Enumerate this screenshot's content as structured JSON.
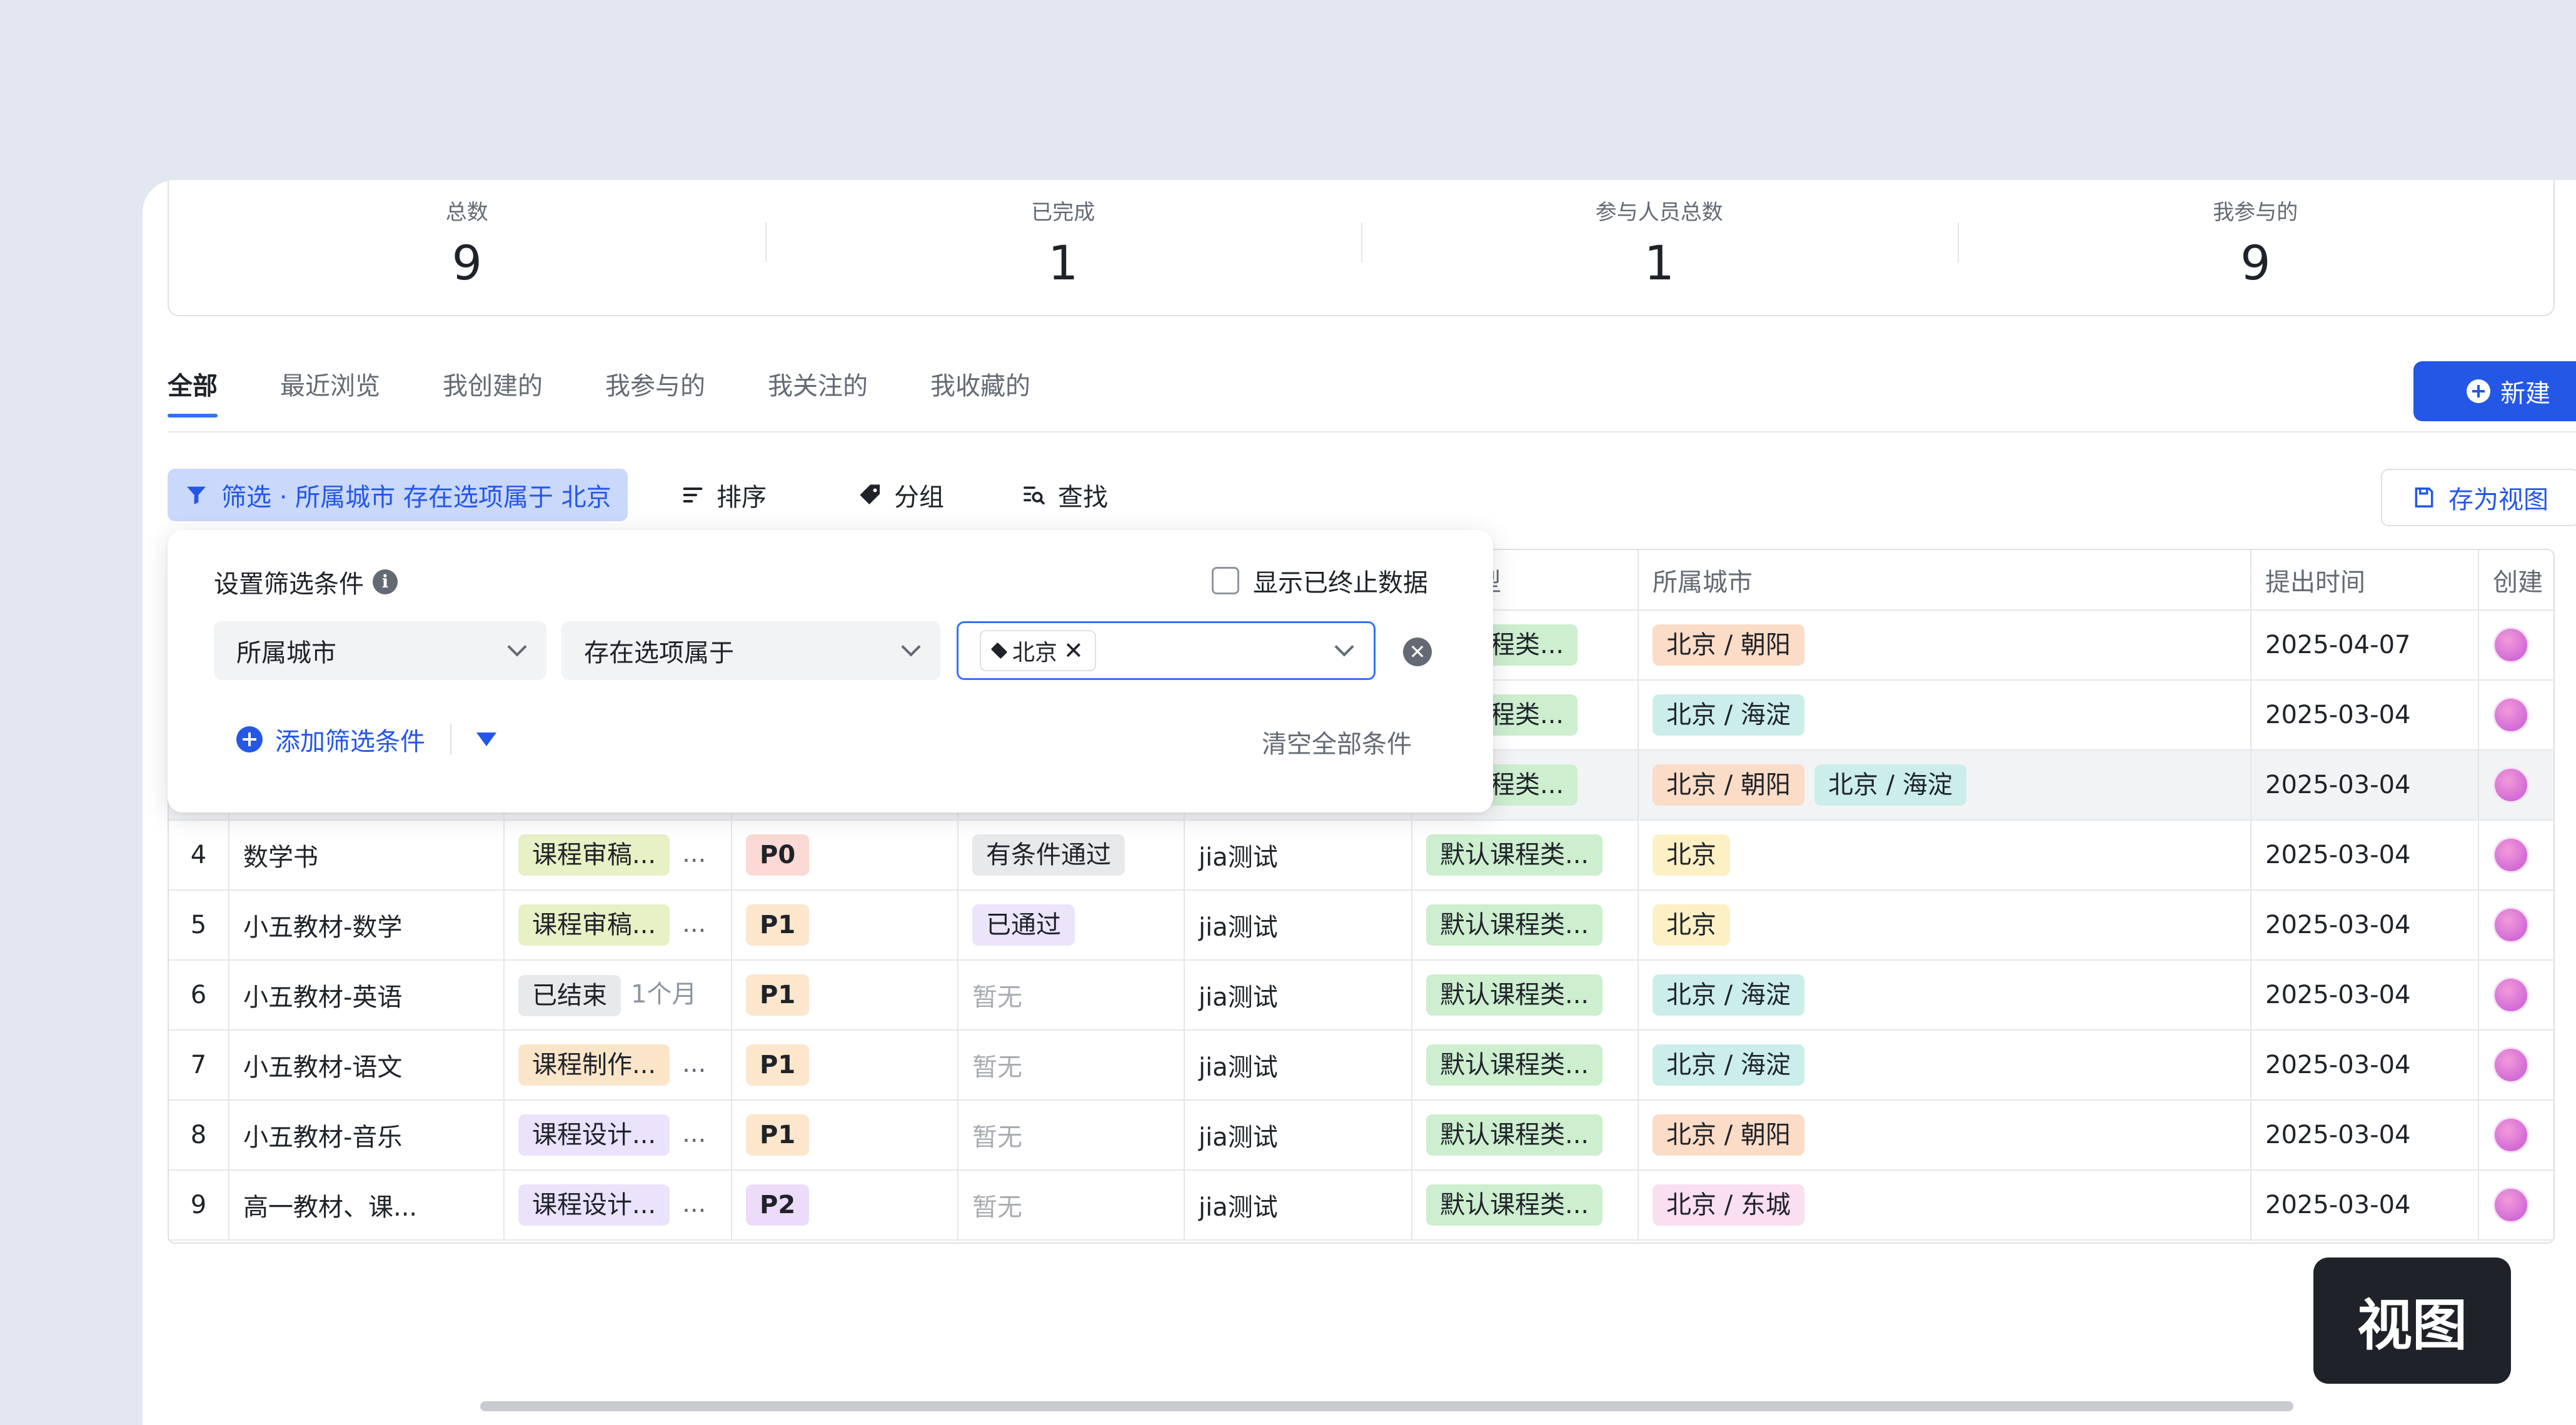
{
  "stats": [
    {
      "label": "总数",
      "value": "9"
    },
    {
      "label": "已完成",
      "value": "1"
    },
    {
      "label": "参与人员总数",
      "value": "1"
    },
    {
      "label": "我参与的",
      "value": "9"
    }
  ],
  "tabs": [
    "全部",
    "最近浏览",
    "我创建的",
    "我参与的",
    "我关注的",
    "我收藏的"
  ],
  "new_button": "新建",
  "toolbar": {
    "filter_label": "筛选 · 所属城市 存在选项属于 北京",
    "sort_label": "排序",
    "group_label": "分组",
    "find_label": "查找",
    "save_view_label": "存为视图"
  },
  "table": {
    "headers": {
      "type": "型类型",
      "city": "所属城市",
      "date": "提出时间",
      "creator": "创建"
    },
    "rows": [
      {
        "idx": "4",
        "name": "数学书",
        "stage": "课程审稿...",
        "duration": "...",
        "priority": "P0",
        "status": "有条件通过",
        "owner": "jia测试",
        "type": "默认课程类...",
        "cities": [
          "北京"
        ],
        "date": "2025-03-04"
      },
      {
        "idx": "5",
        "name": "小五教材-数学",
        "stage": "课程审稿...",
        "duration": "...",
        "priority": "P1",
        "status": "已通过",
        "owner": "jia测试",
        "type": "默认课程类...",
        "cities": [
          "北京"
        ],
        "date": "2025-03-04"
      },
      {
        "idx": "6",
        "name": "小五教材-英语",
        "stage": "已结束",
        "duration": "1个月",
        "priority": "P1",
        "status": "暂无",
        "owner": "jia测试",
        "type": "默认课程类...",
        "cities": [
          "北京 / 海淀"
        ],
        "date": "2025-03-04"
      },
      {
        "idx": "7",
        "name": "小五教材-语文",
        "stage": "课程制作...",
        "duration": "...",
        "priority": "P1",
        "status": "暂无",
        "owner": "jia测试",
        "type": "默认课程类...",
        "cities": [
          "北京 / 海淀"
        ],
        "date": "2025-03-04"
      },
      {
        "idx": "8",
        "name": "小五教材-音乐",
        "stage": "课程设计...",
        "duration": "...",
        "priority": "P1",
        "status": "暂无",
        "owner": "jia测试",
        "type": "默认课程类...",
        "cities": [
          "北京 / 朝阳"
        ],
        "date": "2025-03-04"
      },
      {
        "idx": "9",
        "name": "高一教材、课...",
        "stage": "课程设计...",
        "duration": "...",
        "priority": "P2",
        "status": "暂无",
        "owner": "jia测试",
        "type": "默认课程类...",
        "cities": [
          "北京 / 东城"
        ],
        "date": "2025-03-04"
      }
    ],
    "top_rows": [
      {
        "type": "认课程类...",
        "cities": [
          "北京 / 朝阳"
        ],
        "date": "2025-04-07"
      },
      {
        "type": "认课程类...",
        "cities": [
          "北京 / 海淀"
        ],
        "date": "2025-03-04"
      },
      {
        "type": "认课程类...",
        "cities": [
          "北京 / 朝阳",
          "北京 / 海淀"
        ],
        "date": "2025-03-04"
      }
    ]
  },
  "filter_popover": {
    "title": "设置筛选条件",
    "show_terminated": "显示已终止数据",
    "field": "所属城市",
    "operator": "存在选项属于",
    "value_chip": "北京",
    "add_condition": "添加筛选条件",
    "clear_all": "清空全部条件"
  },
  "view_badge": "视图"
}
